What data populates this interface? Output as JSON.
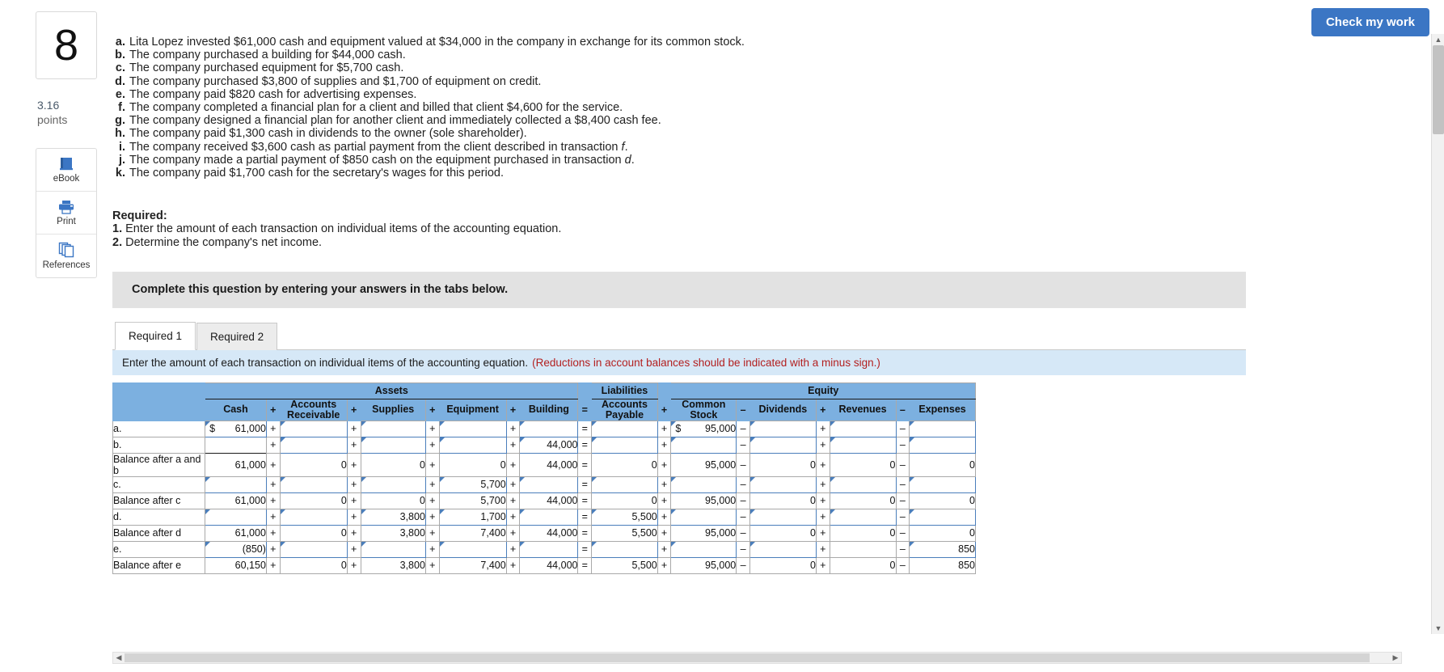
{
  "check_my_work": {
    "label": "Check my work"
  },
  "rail": {
    "question_number": "8",
    "points_value": "3.16",
    "points_label": "points",
    "tools": [
      {
        "name": "ebook",
        "label": "eBook"
      },
      {
        "name": "print",
        "label": "Print"
      },
      {
        "name": "references",
        "label": "References"
      }
    ]
  },
  "transactions": [
    {
      "letter": "a.",
      "text": "Lita Lopez invested $61,000 cash and equipment valued at $34,000 in the company in exchange for its common stock."
    },
    {
      "letter": "b.",
      "text": "The company purchased a building for $44,000 cash."
    },
    {
      "letter": "c.",
      "text": "The company purchased equipment for $5,700 cash."
    },
    {
      "letter": "d.",
      "text": "The company purchased $3,800 of supplies and $1,700 of equipment on credit."
    },
    {
      "letter": "e.",
      "text": "The company paid $820 cash for advertising expenses."
    },
    {
      "letter": "f.",
      "text": "The company completed a financial plan for a client and billed that client $4,600 for the service."
    },
    {
      "letter": "g.",
      "text": "The company designed a financial plan for another client and immediately collected a $8,400 cash fee."
    },
    {
      "letter": "h.",
      "text": "The company paid $1,300 cash in dividends to the owner (sole shareholder)."
    },
    {
      "letter": "i.",
      "text": "The company received $3,600 cash as partial payment from the client described in transaction ",
      "italic_tail": "f",
      "tail": "."
    },
    {
      "letter": "j.",
      "text": "The company made a partial payment of $850 cash on the equipment purchased in transaction ",
      "italic_tail": "d",
      "tail": "."
    },
    {
      "letter": "k.",
      "text": "The company paid $1,700 cash for the secretary's wages for this period."
    }
  ],
  "required": {
    "heading": "Required:",
    "items": [
      {
        "num": "1.",
        "text": "Enter the amount of each transaction on individual items of the accounting equation."
      },
      {
        "num": "2.",
        "text": "Determine the company's net income."
      }
    ]
  },
  "gray_bar": {
    "text": "Complete this question by entering your answers in the tabs below."
  },
  "tabs": [
    {
      "label": "Required 1",
      "active": true
    },
    {
      "label": "Required 2",
      "active": false
    }
  ],
  "instruction_bar": {
    "text": "Enter the amount of each transaction on individual items of the accounting equation.",
    "note": "(Reductions in account balances should be indicated with a minus sign.)"
  },
  "chart_data": {
    "type": "table",
    "title": "Accounting equation worksheet",
    "group_headers": [
      {
        "label": "",
        "span": 1
      },
      {
        "label": "Assets",
        "span": 9
      },
      {
        "label": "",
        "span": 1
      },
      {
        "label": "Liabilities",
        "span": 1
      },
      {
        "label": "",
        "span": 1
      },
      {
        "label": "Equity",
        "span": 7
      }
    ],
    "column_headers": [
      "",
      "Cash",
      "+",
      "Accounts Receivable",
      "+",
      "Supplies",
      "+",
      "Equipment",
      "+",
      "Building",
      "=",
      "Accounts Payable",
      "+",
      "Common Stock",
      "–",
      "Dividends",
      "+",
      "Revenues",
      "–",
      "Expenses"
    ],
    "operators": [
      "+",
      "+",
      "+",
      "+",
      "=",
      "+",
      "–",
      "+",
      "–"
    ],
    "rows": [
      {
        "label": "a.",
        "kind": "entry",
        "cells": [
          {
            "v": "61,000",
            "dollar": "$",
            "editable": true
          },
          {
            "v": "",
            "editable": true
          },
          {
            "v": "",
            "editable": true
          },
          {
            "v": "",
            "editable": true
          },
          {
            "v": "",
            "editable": true
          },
          {
            "v": "",
            "editable": true
          },
          {
            "v": "95,000",
            "dollar": "$",
            "editable": true
          },
          {
            "v": "",
            "editable": true
          },
          {
            "v": "",
            "editable": true
          },
          {
            "v": "",
            "editable": true
          }
        ]
      },
      {
        "label": "b.",
        "kind": "entry",
        "cells": [
          {
            "v": "",
            "editable": true,
            "selected": true
          },
          {
            "v": "",
            "editable": true
          },
          {
            "v": "",
            "editable": true
          },
          {
            "v": "",
            "editable": true
          },
          {
            "v": "44,000",
            "editable": true
          },
          {
            "v": "",
            "editable": true
          },
          {
            "v": "",
            "editable": true
          },
          {
            "v": "",
            "editable": true
          },
          {
            "v": "",
            "editable": true
          },
          {
            "v": "",
            "editable": true
          }
        ]
      },
      {
        "label": "Balance after a and b",
        "kind": "balance",
        "cells": [
          {
            "v": "61,000"
          },
          {
            "v": "0"
          },
          {
            "v": "0"
          },
          {
            "v": "0"
          },
          {
            "v": "44,000"
          },
          {
            "v": "0"
          },
          {
            "v": "95,000"
          },
          {
            "v": "0"
          },
          {
            "v": "0"
          },
          {
            "v": "0"
          }
        ]
      },
      {
        "label": "c.",
        "kind": "entry",
        "cells": [
          {
            "v": "",
            "editable": true
          },
          {
            "v": "",
            "editable": true
          },
          {
            "v": "",
            "editable": true
          },
          {
            "v": "5,700",
            "editable": true
          },
          {
            "v": "",
            "editable": true
          },
          {
            "v": "",
            "editable": true
          },
          {
            "v": "",
            "editable": true
          },
          {
            "v": "",
            "editable": true
          },
          {
            "v": "",
            "editable": true
          },
          {
            "v": "",
            "editable": true
          }
        ]
      },
      {
        "label": "Balance after c",
        "kind": "balance",
        "cells": [
          {
            "v": "61,000"
          },
          {
            "v": "0"
          },
          {
            "v": "0"
          },
          {
            "v": "5,700"
          },
          {
            "v": "44,000"
          },
          {
            "v": "0"
          },
          {
            "v": "95,000"
          },
          {
            "v": "0"
          },
          {
            "v": "0"
          },
          {
            "v": "0"
          }
        ]
      },
      {
        "label": "d.",
        "kind": "entry",
        "cells": [
          {
            "v": "",
            "editable": true
          },
          {
            "v": "",
            "editable": true
          },
          {
            "v": "3,800",
            "editable": true
          },
          {
            "v": "1,700",
            "editable": true
          },
          {
            "v": "",
            "editable": true
          },
          {
            "v": "5,500",
            "editable": true
          },
          {
            "v": "",
            "editable": true
          },
          {
            "v": "",
            "editable": true
          },
          {
            "v": "",
            "editable": true
          },
          {
            "v": "",
            "editable": true
          }
        ]
      },
      {
        "label": "Balance after d",
        "kind": "balance",
        "cells": [
          {
            "v": "61,000"
          },
          {
            "v": "0"
          },
          {
            "v": "3,800"
          },
          {
            "v": "7,400"
          },
          {
            "v": "44,000"
          },
          {
            "v": "5,500"
          },
          {
            "v": "95,000"
          },
          {
            "v": "0"
          },
          {
            "v": "0"
          },
          {
            "v": "0"
          }
        ]
      },
      {
        "label": "e.",
        "kind": "entry",
        "cells": [
          {
            "v": "(850)",
            "editable": true
          },
          {
            "v": "",
            "editable": true
          },
          {
            "v": "",
            "editable": true
          },
          {
            "v": "",
            "editable": true
          },
          {
            "v": "",
            "editable": true
          },
          {
            "v": "",
            "editable": true
          },
          {
            "v": "",
            "editable": true
          },
          {
            "v": "",
            "editable": true
          },
          {
            "v": ""
          },
          {
            "v": "850",
            "editable": true
          }
        ]
      },
      {
        "label": "Balance after e",
        "kind": "balance",
        "cells": [
          {
            "v": "60,150"
          },
          {
            "v": "0"
          },
          {
            "v": "3,800"
          },
          {
            "v": "7,400"
          },
          {
            "v": "44,000"
          },
          {
            "v": "5,500"
          },
          {
            "v": "95,000"
          },
          {
            "v": "0"
          },
          {
            "v": "0"
          },
          {
            "v": "850"
          }
        ]
      }
    ]
  }
}
